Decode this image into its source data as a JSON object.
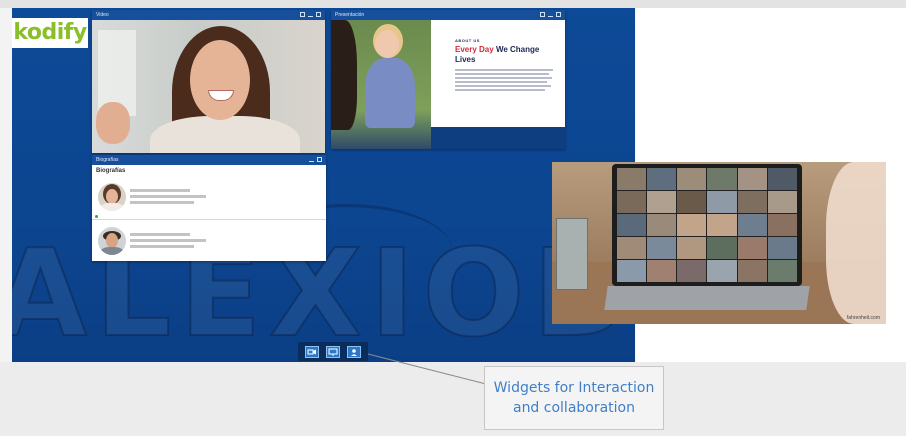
{
  "logo": {
    "text": "kodify"
  },
  "watermark": {
    "text": "ALEXIOD"
  },
  "windows": {
    "video": {
      "title": "Video"
    },
    "presentation": {
      "title": "Presentación",
      "slide": {
        "eyebrow": "ABOUT US",
        "headline_red": "Every Day",
        "headline_rest": "We Change Lives"
      }
    },
    "bio": {
      "title": "Biografías",
      "heading": "Biografías"
    }
  },
  "toolbar": {
    "buttons": [
      {
        "icon": "video-camera-icon"
      },
      {
        "icon": "presentation-screen-icon"
      },
      {
        "icon": "user-card-icon"
      }
    ]
  },
  "callout": {
    "text": "Widgets for Interaction\nand collaboration"
  },
  "photo": {
    "credit": "fahrenheit.com"
  },
  "colors": {
    "stage": "#0d4a97",
    "window_bar": "#164f9c",
    "accent_red": "#d8293b",
    "logo_green": "#8bbf2a",
    "callout_blue": "#3f7fc8"
  }
}
